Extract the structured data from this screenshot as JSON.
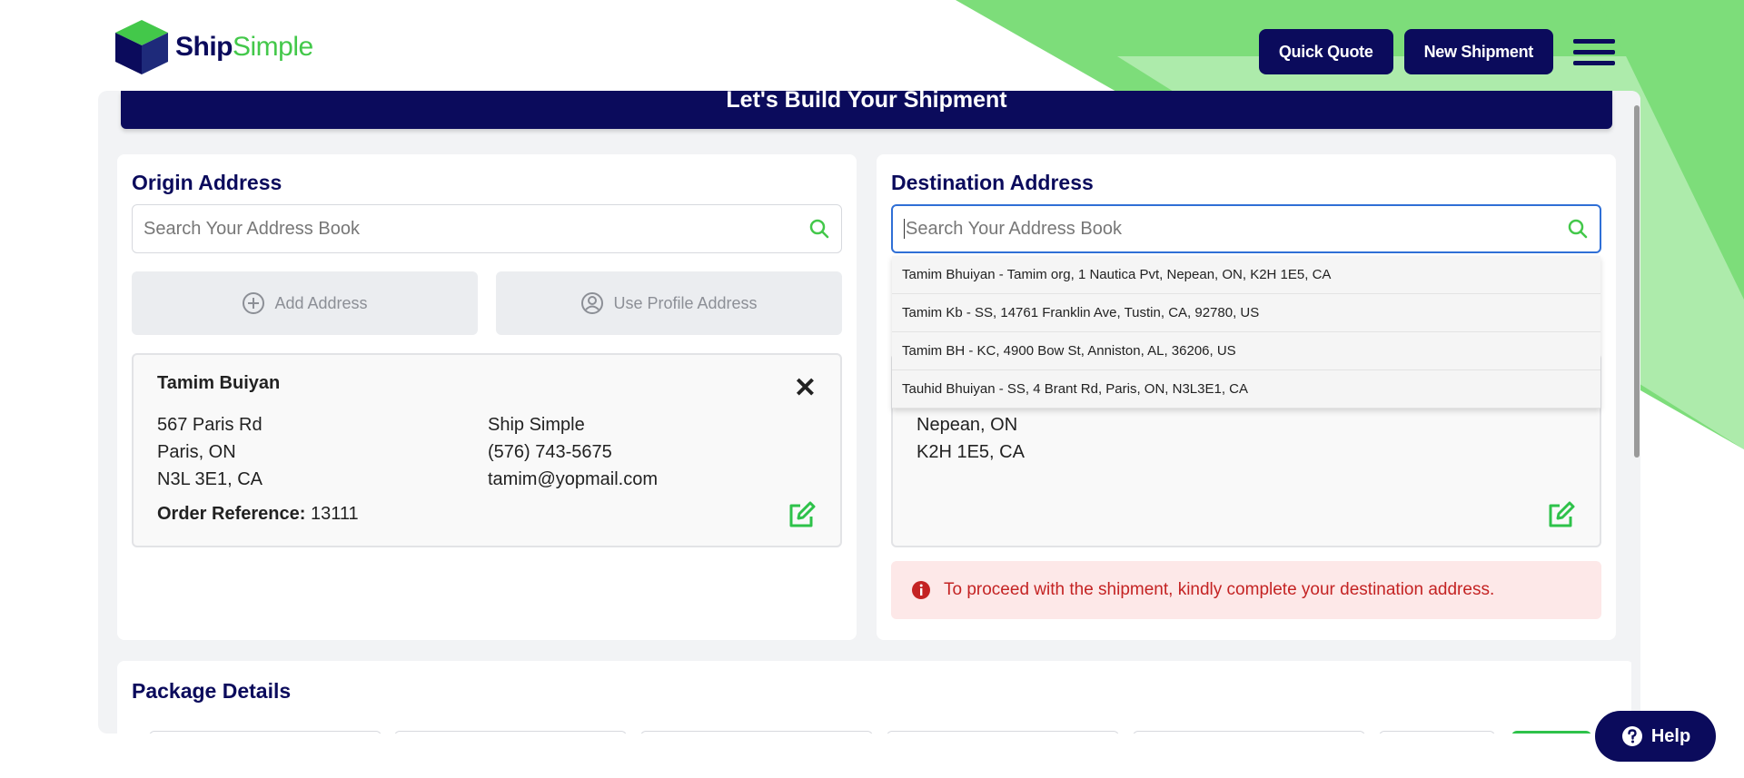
{
  "brand": {
    "name_part1": "Ship",
    "name_part2": "Simple",
    "accent_color": "#43c84a",
    "navy_color": "#0b0b5c"
  },
  "header": {
    "quick_quote": "Quick Quote",
    "new_shipment": "New Shipment"
  },
  "page": {
    "banner_title": "Let's Build Your Shipment"
  },
  "origin": {
    "title": "Origin Address",
    "search_placeholder": "Search Your Address Book",
    "add_address": "Add Address",
    "use_profile": "Use Profile Address",
    "name": "Tamim Buiyan",
    "address_line1": "567 Paris Rd",
    "address_line2": "Paris, ON",
    "address_line3": "N3L 3E1, CA",
    "company": "Ship Simple",
    "phone": "(576) 743-5675",
    "email": "tamim@yopmail.com",
    "order_ref_label": "Order Reference:",
    "order_ref_value": "13111"
  },
  "destination": {
    "title": "Destination Address",
    "search_placeholder": "Search Your Address Book",
    "suggestions": [
      "Tamim Bhuiyan - Tamim org, 1 Nautica Pvt, Nepean, ON, K2H 1E5, CA",
      "Tamim Kb - SS, 14761 Franklin Ave, Tustin, CA, 92780, US",
      "Tamim BH - KC, 4900 Bow St, Anniston, AL, 36206, US",
      "Tauhid Bhuiyan - SS, 4 Brant Rd, Paris, ON, N3L3E1, CA"
    ],
    "address_line2": "Nepean, ON",
    "address_line3": "K2H 1E5, CA",
    "alert": "To proceed with the shipment, kindly complete your destination address."
  },
  "package": {
    "title": "Package Details"
  },
  "help": {
    "label": "Help"
  }
}
